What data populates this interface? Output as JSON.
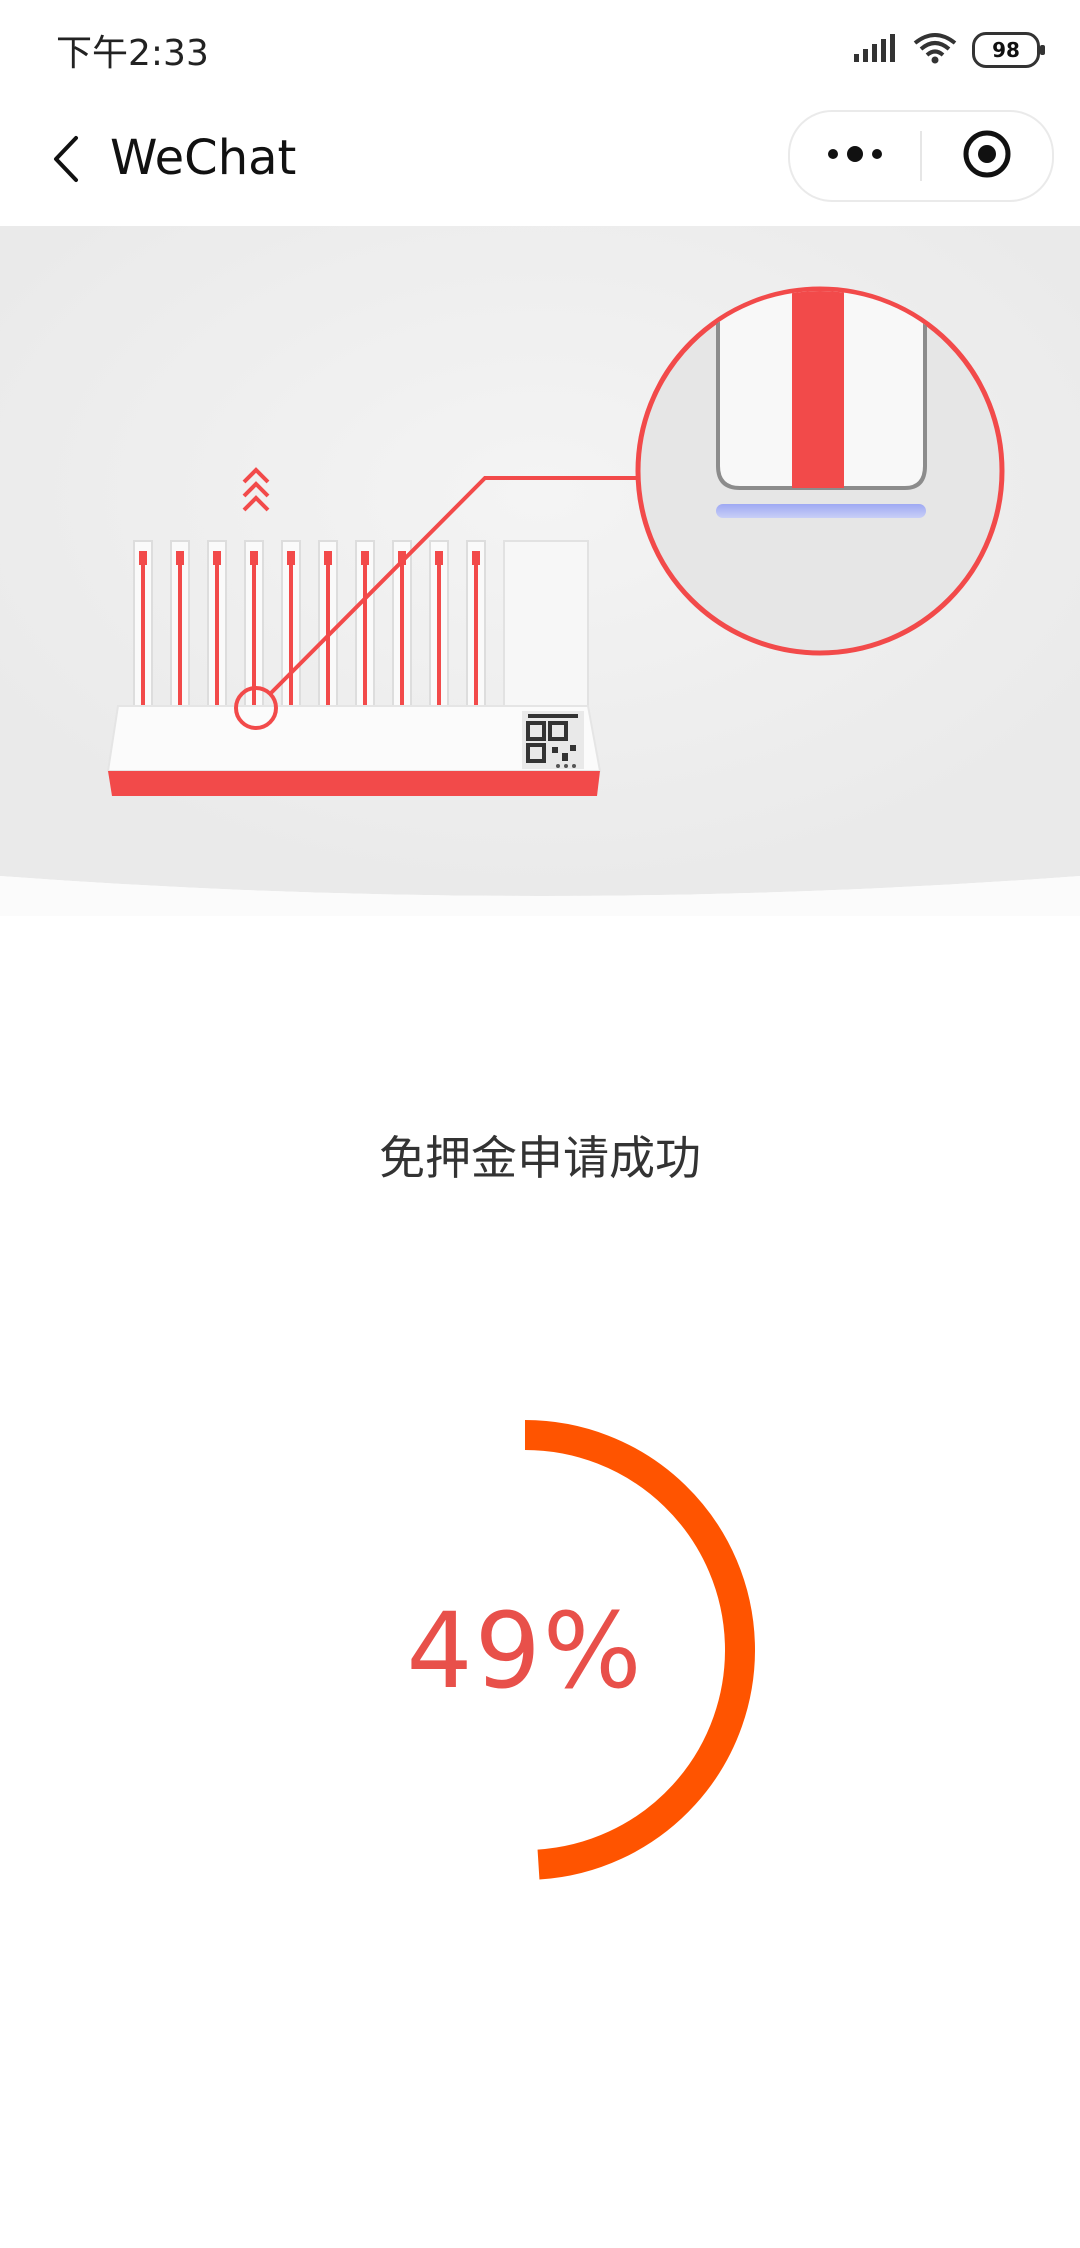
{
  "status_bar": {
    "time": "下午2:33",
    "battery": "98",
    "signal_icon": "signal-icon",
    "wifi_icon": "wifi-icon"
  },
  "nav": {
    "back_icon": "chevron-left-icon",
    "title": "WeChat",
    "more_icon": "more-dots-icon",
    "close_icon": "target-close-icon"
  },
  "message": "免押金申请成功",
  "progress": {
    "value": 49,
    "label": "49%",
    "color": "#ff5400",
    "text_color": "#e8504a"
  },
  "colors": {
    "accent_red": "#f24a4a",
    "hero_bg": "#efefef"
  }
}
